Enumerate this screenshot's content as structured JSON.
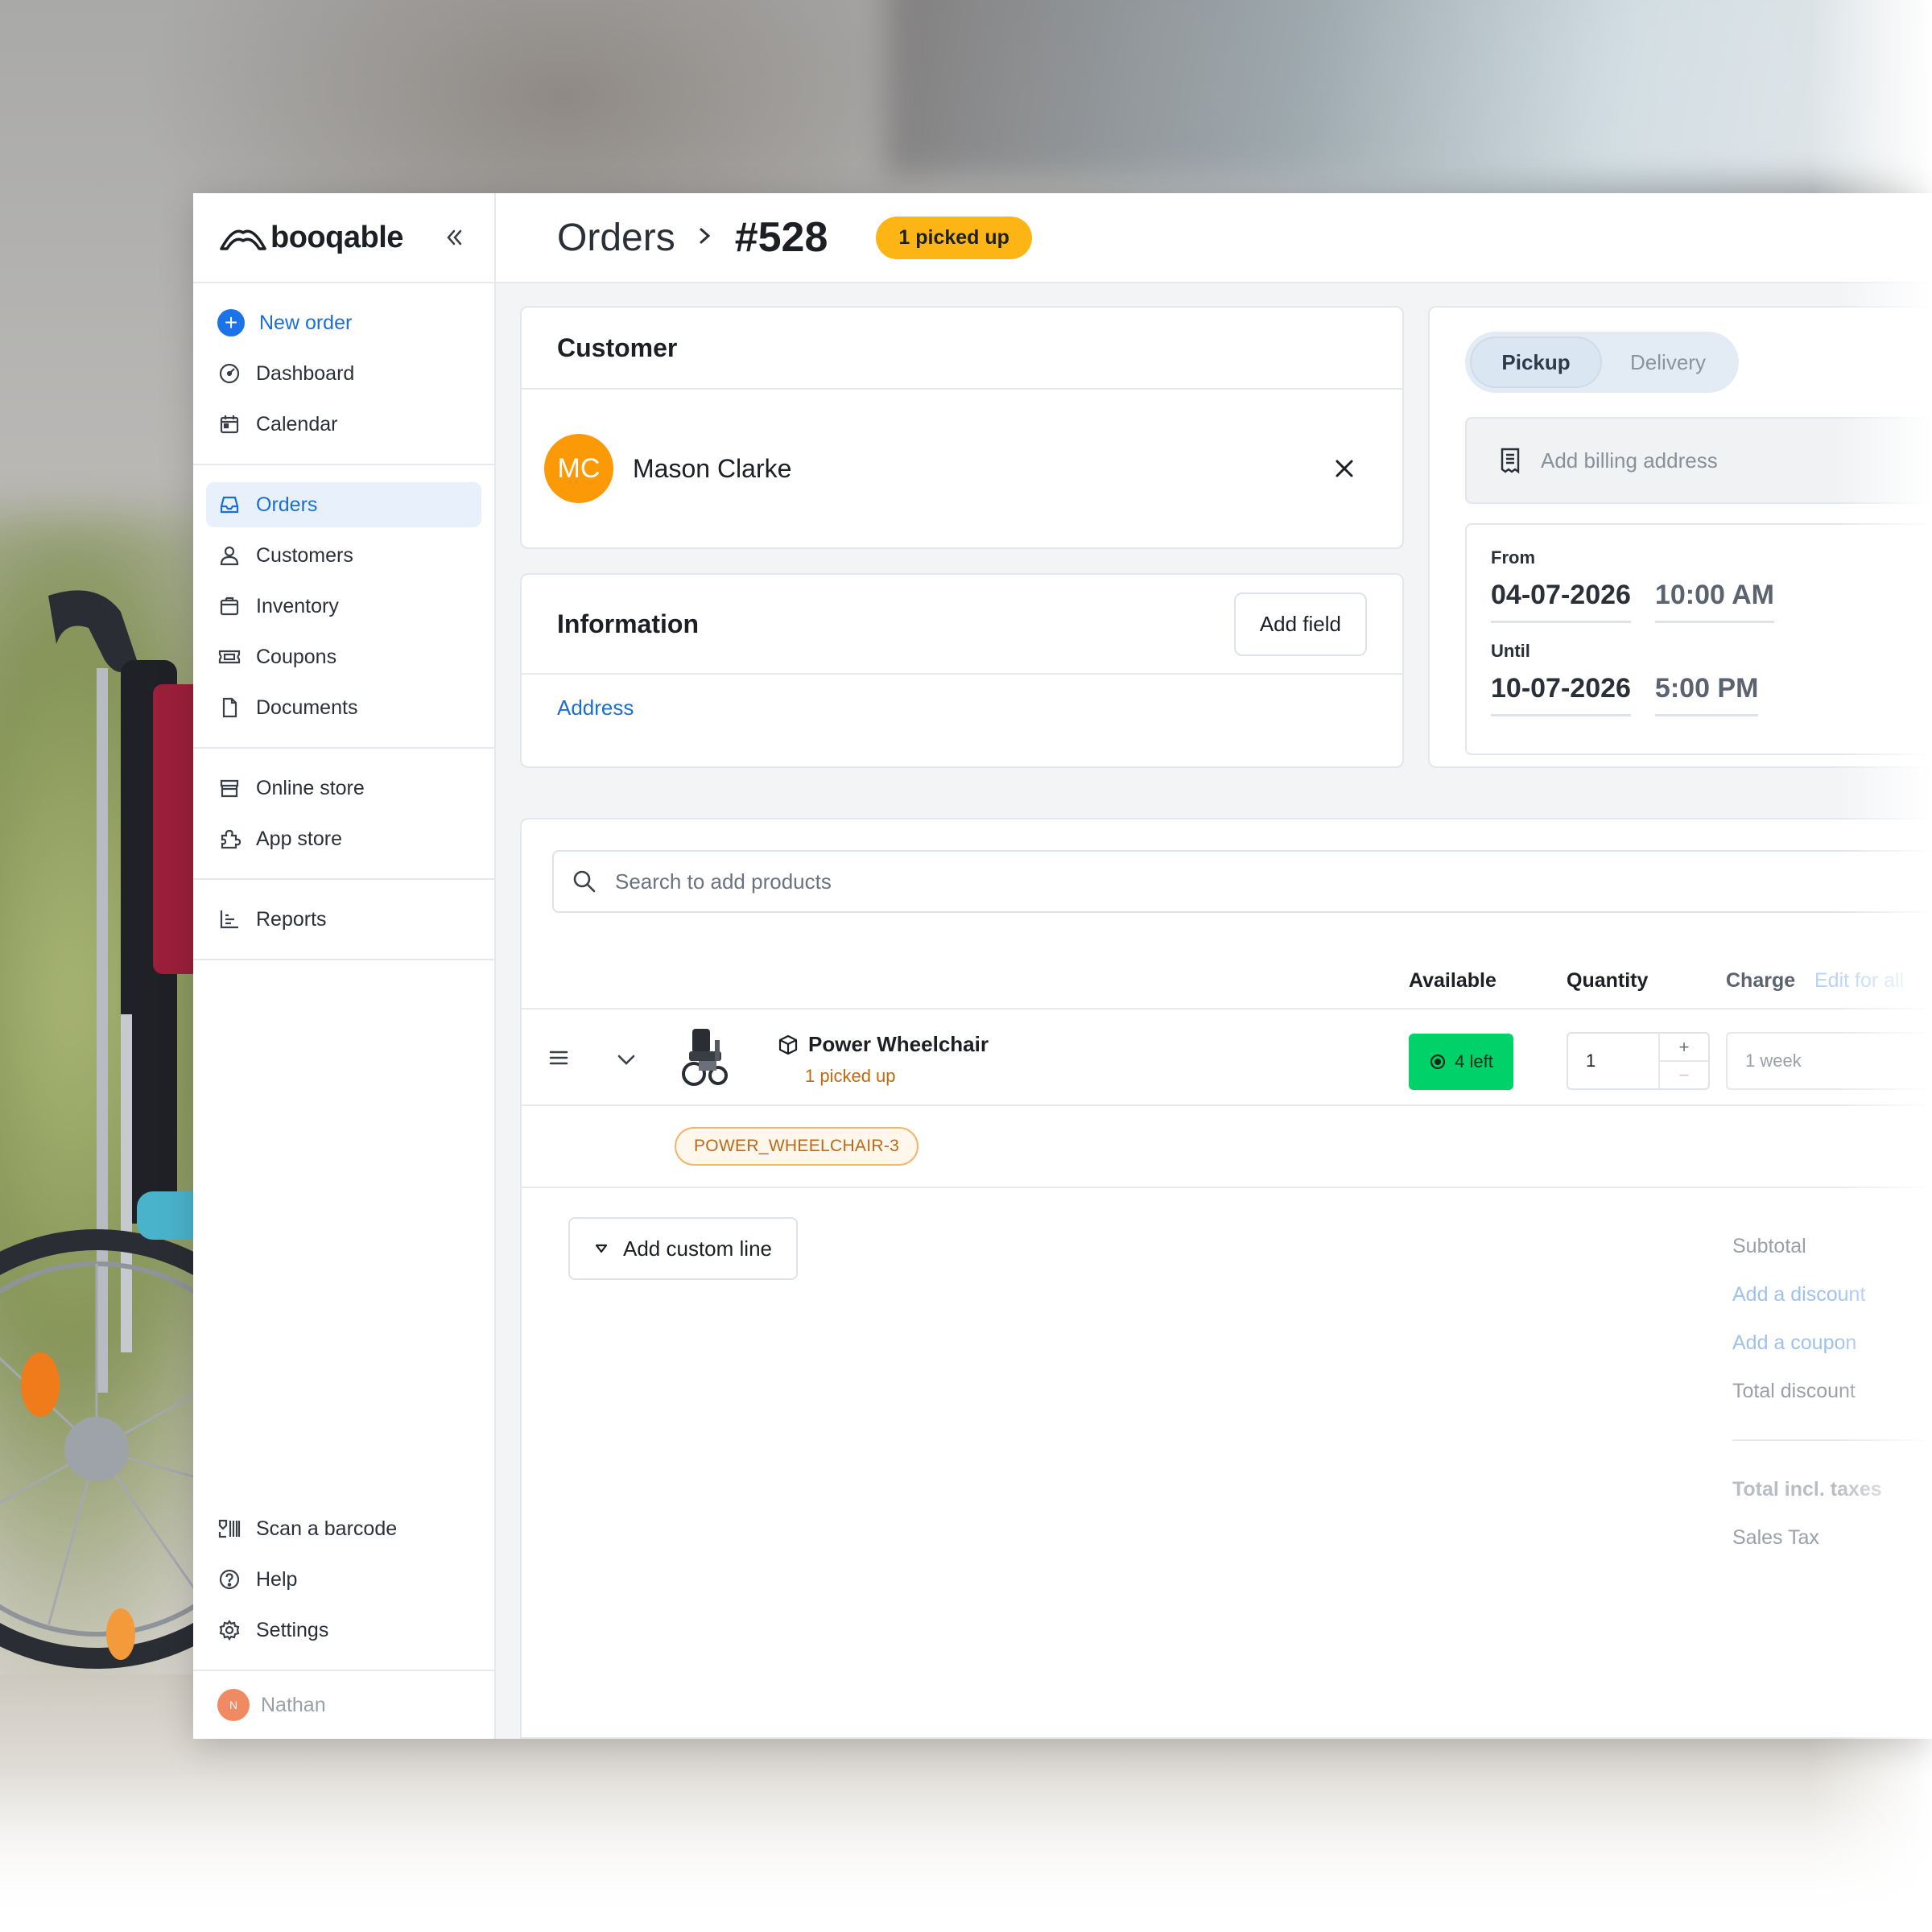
{
  "app": {
    "brand": "booqable",
    "colors": {
      "accent": "#1a73e8",
      "status_pill": "#fdb515",
      "available": "#00d26a",
      "avatar": "#fb9a06"
    }
  },
  "sidebar": {
    "new_order": "New order",
    "items": [
      {
        "label": "Dashboard",
        "icon": "dashboard-icon"
      },
      {
        "label": "Calendar",
        "icon": "calendar-icon"
      },
      {
        "label": "Orders",
        "icon": "inbox-icon",
        "active": true
      },
      {
        "label": "Customers",
        "icon": "user-icon"
      },
      {
        "label": "Inventory",
        "icon": "box-icon"
      },
      {
        "label": "Coupons",
        "icon": "ticket-icon"
      },
      {
        "label": "Documents",
        "icon": "document-icon"
      },
      {
        "label": "Online store",
        "icon": "store-icon"
      },
      {
        "label": "App store",
        "icon": "puzzle-icon"
      },
      {
        "label": "Reports",
        "icon": "chart-icon"
      }
    ],
    "bottom_items": [
      {
        "label": "Scan a barcode",
        "icon": "barcode-icon"
      },
      {
        "label": "Help",
        "icon": "help-icon"
      },
      {
        "label": "Settings",
        "icon": "gear-icon"
      }
    ],
    "user": {
      "initial": "N",
      "name": "Nathan"
    }
  },
  "header": {
    "section": "Orders",
    "order_id": "#528",
    "status": "1 picked up"
  },
  "customer": {
    "title": "Customer",
    "initials": "MC",
    "name": "Mason Clarke"
  },
  "information": {
    "title": "Information",
    "add_field": "Add field",
    "address_link": "Address"
  },
  "fulfillment": {
    "tabs": [
      "Pickup",
      "Delivery"
    ],
    "selected": "Pickup",
    "billing_placeholder": "Add billing address",
    "from_label": "From",
    "from_date": "04-07-2026",
    "from_time": "10:00 AM",
    "until_label": "Until",
    "until_date": "10-07-2026",
    "until_time": "5:00 PM"
  },
  "products": {
    "search_placeholder": "Search to add products",
    "columns": {
      "available": "Available",
      "quantity": "Quantity",
      "charge": "Charge",
      "edit_all": "Edit for all"
    },
    "lines": [
      {
        "name": "Power Wheelchair",
        "status": "1 picked up",
        "available": "4 left",
        "quantity": "1",
        "charge": "1 week",
        "sku": "POWER_WHEELCHAIR-3"
      }
    ],
    "add_custom_line": "Add custom line"
  },
  "totals": {
    "subtotal": "Subtotal",
    "add_discount": "Add a discount",
    "add_coupon": "Add a coupon",
    "total_discount": "Total discount",
    "total_incl_taxes": "Total incl. taxes",
    "sales_tax": "Sales Tax"
  }
}
